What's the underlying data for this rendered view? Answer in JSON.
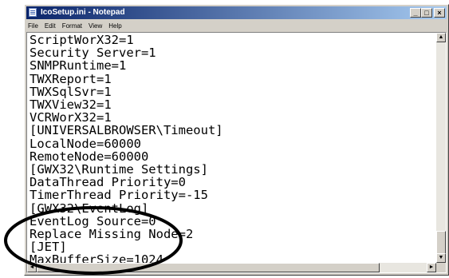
{
  "window": {
    "title": "IcoSetup.ini - Notepad"
  },
  "caption_buttons": {
    "minimize": "_",
    "maximize": "□",
    "close": "×"
  },
  "menu": {
    "items": [
      "File",
      "Edit",
      "Format",
      "View",
      "Help"
    ]
  },
  "document": {
    "lines": [
      "ScriptWorX32=1",
      "Security Server=1",
      "SNMPRuntime=1",
      "TWXReport=1",
      "TWXSqlSvr=1",
      "TWXView32=1",
      "VCRWorX32=1",
      "[UNIVERSALBROWSER\\Timeout]",
      "LocalNode=60000",
      "RemoteNode=60000",
      "[GWX32\\Runtime Settings]",
      "DataThread Priority=0",
      "TimerThread Priority=-15",
      "[GWX32\\EventLog]",
      "EventLog Source=0",
      "Replace Missing Node=2",
      "[JET]",
      "MaxBufferSize=1024"
    ]
  },
  "scrollbar_icons": {
    "up": "▲",
    "down": "▼",
    "left": "◄",
    "right": "►"
  },
  "colors": {
    "titlebar_start": "#0a246a",
    "titlebar_end": "#a6caf0",
    "highlight_ellipse": "#000000"
  }
}
